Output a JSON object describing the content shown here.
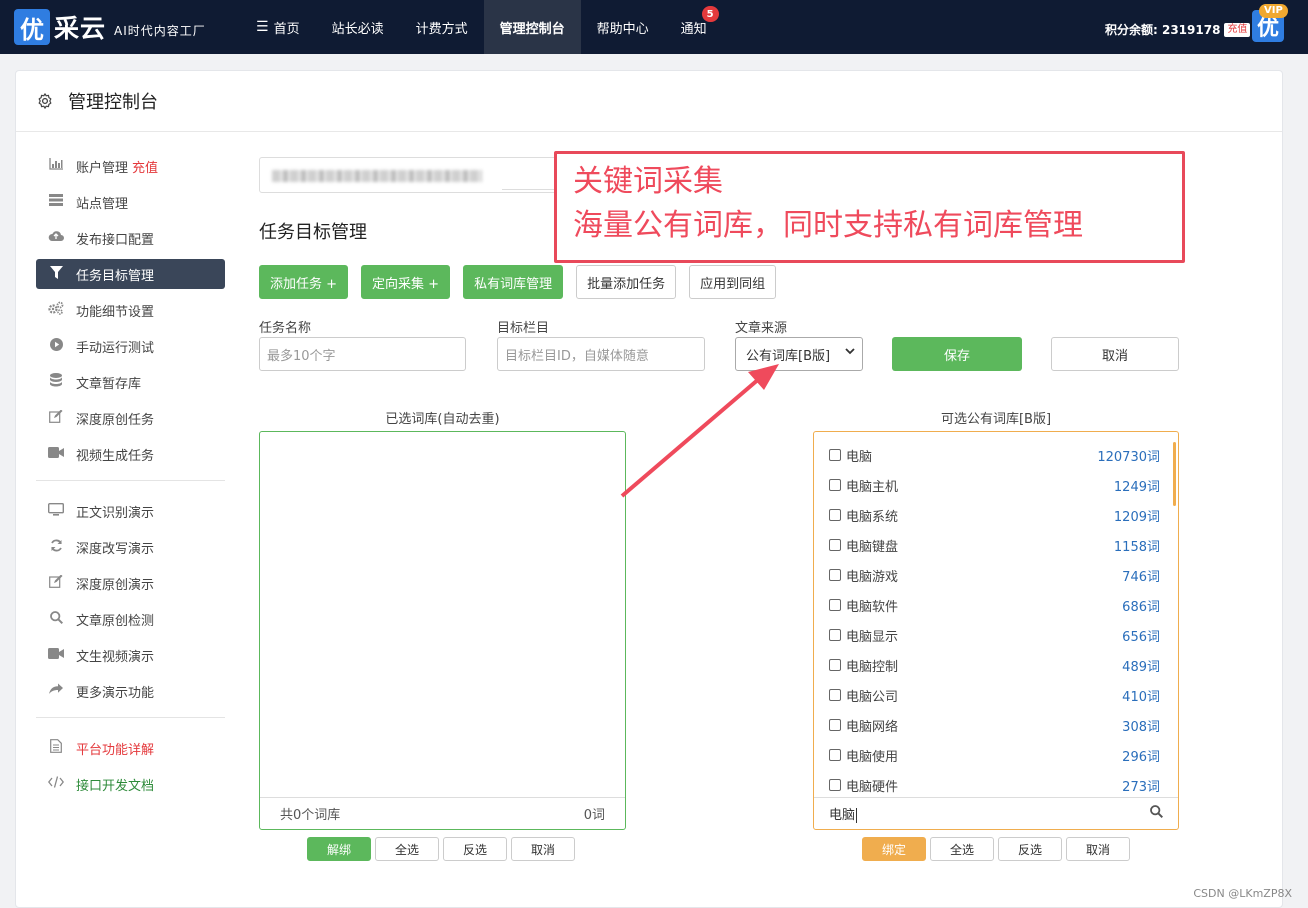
{
  "topbar": {
    "logo_char": "优",
    "logo_text": "采云",
    "slogan": "AI时代内容工厂",
    "nav": [
      {
        "label": "首页"
      },
      {
        "label": "站长必读"
      },
      {
        "label": "计费方式"
      },
      {
        "label": "管理控制台"
      },
      {
        "label": "帮助中心"
      },
      {
        "label": "通知",
        "badge": "5"
      }
    ],
    "balance_label": "积分余额: 2319178",
    "recharge": "充值",
    "avatar_char": "优",
    "vip": "VIP"
  },
  "page": {
    "title": "管理控制台"
  },
  "sidebar": {
    "items": [
      {
        "label": "账户管理",
        "extra": "充值",
        "icon": "bar-chart-icon"
      },
      {
        "label": "站点管理",
        "icon": "list-icon"
      },
      {
        "label": "发布接口配置",
        "icon": "cloud-upload-icon"
      },
      {
        "label": "任务目标管理",
        "icon": "filter-icon"
      },
      {
        "label": "功能细节设置",
        "icon": "gears-icon"
      },
      {
        "label": "手动运行测试",
        "icon": "play-icon"
      },
      {
        "label": "文章暂存库",
        "icon": "database-icon"
      },
      {
        "label": "深度原创任务",
        "icon": "edit-icon"
      },
      {
        "label": "视频生成任务",
        "icon": "video-icon"
      }
    ],
    "demo_items": [
      {
        "label": "正文识别演示",
        "icon": "monitor-icon"
      },
      {
        "label": "深度改写演示",
        "icon": "refresh-icon"
      },
      {
        "label": "深度原创演示",
        "icon": "edit-icon"
      },
      {
        "label": "文章原创检测",
        "icon": "search-icon"
      },
      {
        "label": "文生视频演示",
        "icon": "video-icon"
      },
      {
        "label": "更多演示功能",
        "icon": "share-icon"
      }
    ],
    "doc_items": [
      {
        "label": "平台功能详解",
        "icon": "document-icon"
      },
      {
        "label": "接口开发文档",
        "icon": "code-icon"
      }
    ]
  },
  "main": {
    "section_title": "任务目标管理",
    "buttons": {
      "add_task": "添加任务 +",
      "directed_collect": "定向采集 +",
      "private_lib": "私有词库管理",
      "batch_add": "批量添加任务",
      "apply_group": "应用到同组"
    },
    "form": {
      "task_name_label": "任务名称",
      "task_name_placeholder": "最多10个字",
      "target_column_label": "目标栏目",
      "target_column_placeholder": "目标栏目ID，自媒体随意",
      "source_label": "文章来源",
      "source_value": "公有词库[B版]",
      "save": "保存",
      "cancel": "取消"
    },
    "selected_libs": {
      "title": "已选词库(自动去重)",
      "footer_count": "共0个词库",
      "footer_words": "0词",
      "buttons": [
        "解绑",
        "全选",
        "反选",
        "取消"
      ]
    },
    "available_libs": {
      "title": "可选公有词库[B版]",
      "items": [
        {
          "name": "电脑",
          "count": "120730词"
        },
        {
          "name": "电脑主机",
          "count": "1249词"
        },
        {
          "name": "电脑系统",
          "count": "1209词"
        },
        {
          "name": "电脑键盘",
          "count": "1158词"
        },
        {
          "name": "电脑游戏",
          "count": "746词"
        },
        {
          "name": "电脑软件",
          "count": "686词"
        },
        {
          "name": "电脑显示",
          "count": "656词"
        },
        {
          "name": "电脑控制",
          "count": "489词"
        },
        {
          "name": "电脑公司",
          "count": "410词"
        },
        {
          "name": "电脑网络",
          "count": "308词"
        },
        {
          "name": "电脑使用",
          "count": "296词"
        },
        {
          "name": "电脑硬件",
          "count": "273词"
        }
      ],
      "search_value": "电脑",
      "buttons": [
        "绑定",
        "全选",
        "反选",
        "取消"
      ]
    }
  },
  "annotation": {
    "line1": "关键词采集",
    "line2": "海量公有词库，同时支持私有词库管理"
  },
  "watermark": "CSDN @LKmZP8X",
  "colors": {
    "nav_bg": "#0f1b33",
    "green": "#5cb85c",
    "orange": "#f0ad4e",
    "annotation_red": "#e8495a",
    "link_blue": "#2a6ebb"
  }
}
